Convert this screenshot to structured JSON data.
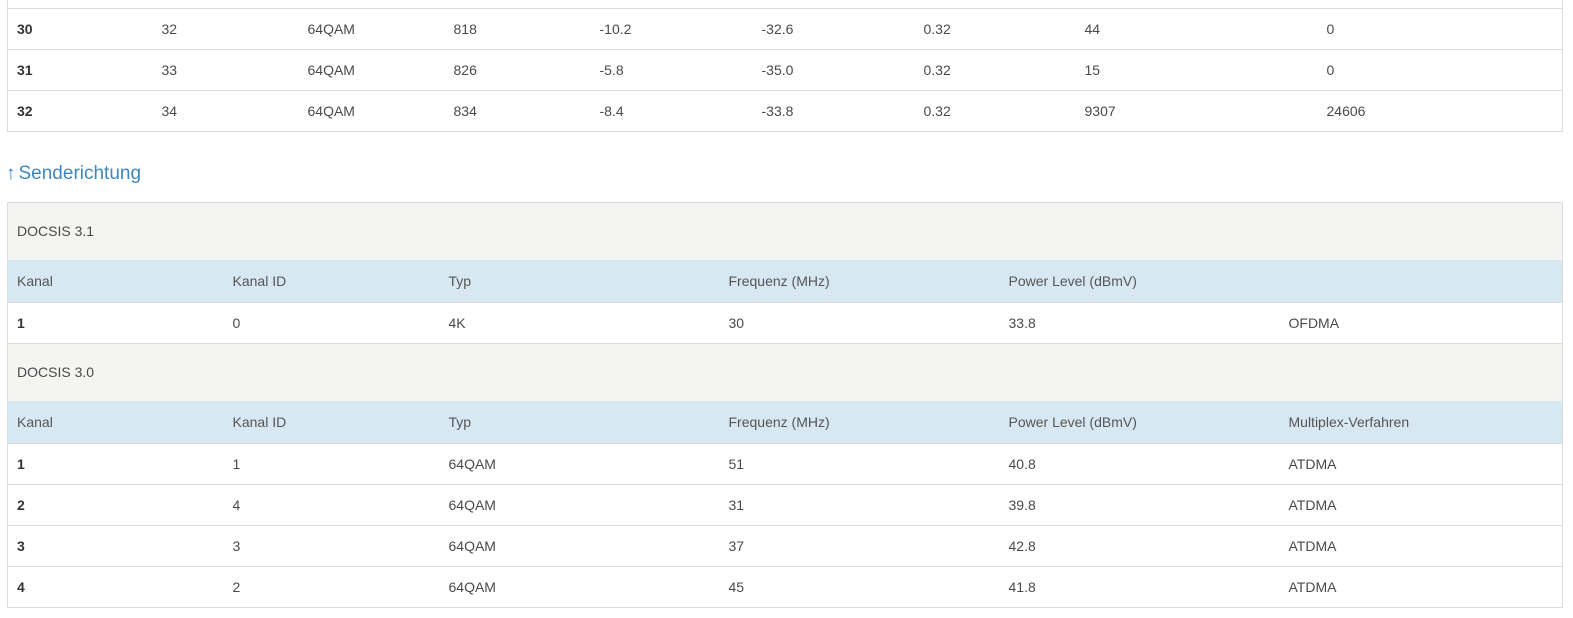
{
  "downstream": {
    "rows": [
      [
        "30",
        "32",
        "64QAM",
        "818",
        "-10.2",
        "-32.6",
        "0.32",
        "44",
        "0"
      ],
      [
        "31",
        "33",
        "64QAM",
        "826",
        "-5.8",
        "-35.0",
        "0.32",
        "15",
        "0"
      ],
      [
        "32",
        "34",
        "64QAM",
        "834",
        "-8.4",
        "-33.8",
        "0.32",
        "9307",
        "24606"
      ]
    ]
  },
  "upstream": {
    "arrow": "↑",
    "title": "Senderichtung",
    "docsis31": {
      "label": "DOCSIS 3.1",
      "headers": [
        "Kanal",
        "Kanal ID",
        "Typ",
        "Frequenz (MHz)",
        "Power Level (dBmV)",
        ""
      ],
      "rows": [
        [
          "1",
          "0",
          "4K",
          "30",
          "33.8",
          "OFDMA"
        ]
      ]
    },
    "docsis30": {
      "label": "DOCSIS 3.0",
      "headers": [
        "Kanal",
        "Kanal ID",
        "Typ",
        "Frequenz (MHz)",
        "Power Level (dBmV)",
        "Multiplex-Verfahren"
      ],
      "rows": [
        [
          "1",
          "1",
          "64QAM",
          "51",
          "40.8",
          "ATDMA"
        ],
        [
          "2",
          "4",
          "64QAM",
          "31",
          "39.8",
          "ATDMA"
        ],
        [
          "3",
          "3",
          "64QAM",
          "37",
          "42.8",
          "ATDMA"
        ],
        [
          "4",
          "2",
          "64QAM",
          "45",
          "41.8",
          "ATDMA"
        ]
      ]
    }
  }
}
